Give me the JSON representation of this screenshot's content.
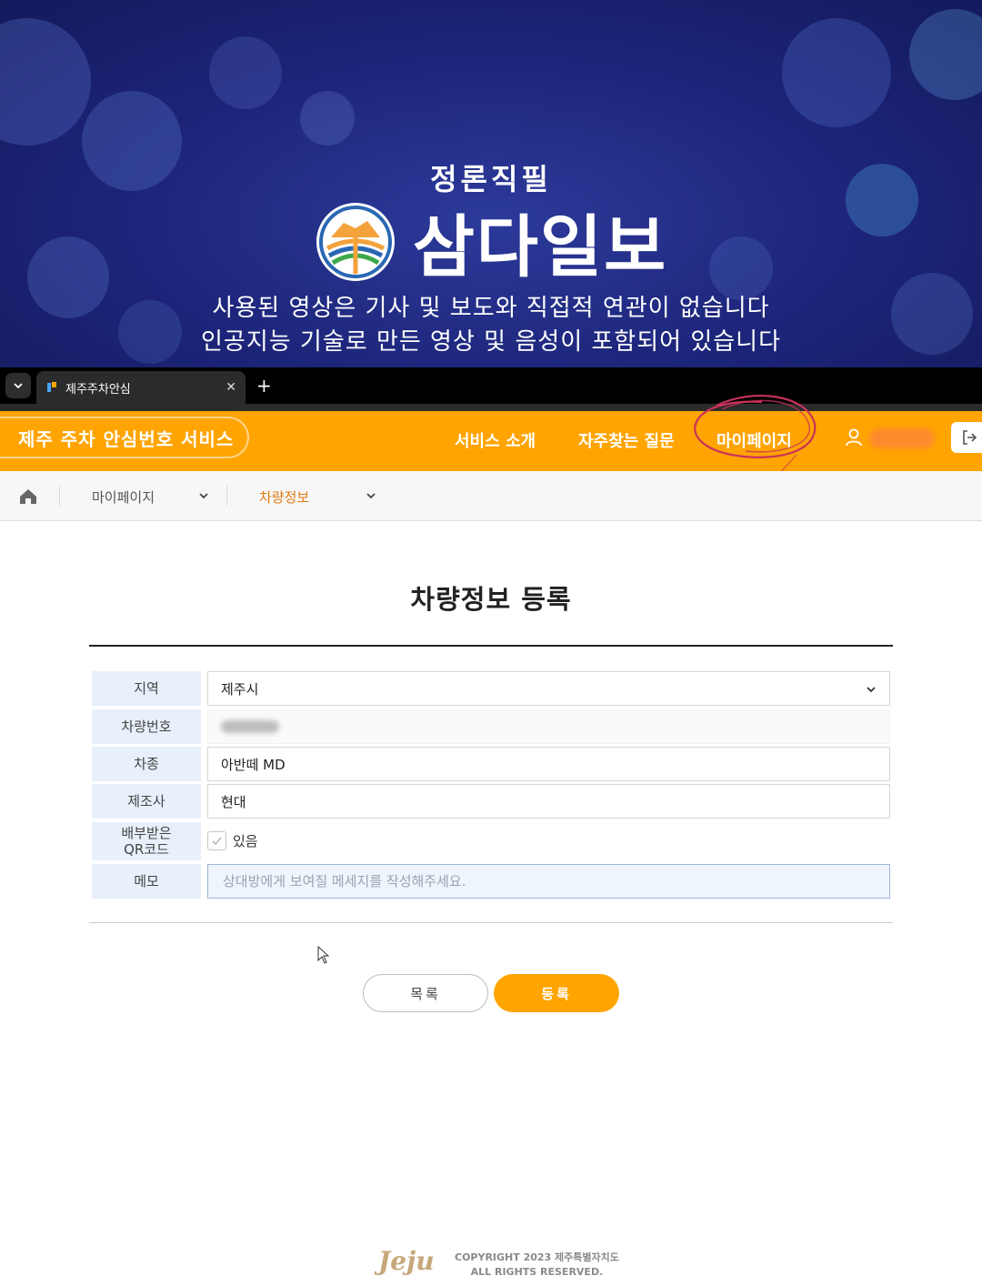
{
  "banner": {
    "slogan": "정론직필",
    "logo_name": "삼다일보",
    "line1": "사용된 영상은 기사 및 보도와 직접적 연관이 없습니다",
    "line2": "인공지능 기술로 만든 영상 및 음성이 포함되어 있습니다"
  },
  "browser": {
    "tab_title": "제주주차안심",
    "close_glyph": "✕",
    "new_tab_glyph": "+",
    "dropdown_glyph": "⌄"
  },
  "header": {
    "brand": "제주 주차 안심번호 서비스",
    "nav": [
      "서비스 소개",
      "자주찾는 질문",
      "마이페이지"
    ],
    "accent_color": "#ffa400"
  },
  "breadcrumb": {
    "level1": "마이페이지",
    "level2": "차량정보"
  },
  "page_title": "차량정보 등록",
  "form": {
    "region_label": "지역",
    "region_value": "제주시",
    "plate_label": "차량번호",
    "model_label": "차종",
    "model_value": "아반떼 MD",
    "maker_label": "제조사",
    "maker_value": "현대",
    "qr_label_line1": "배부받은",
    "qr_label_line2": "QR코드",
    "qr_option": "있음",
    "memo_label": "메모",
    "memo_placeholder": "상대방에게 보여질 메세지를 작성해주세요."
  },
  "buttons": {
    "list": "목록",
    "submit": "등록"
  },
  "footer": {
    "logo": "Jeju",
    "copyright": "COPYRIGHT 2023 제주특별자치도",
    "rights": "ALL RIGHTS RESERVED."
  }
}
